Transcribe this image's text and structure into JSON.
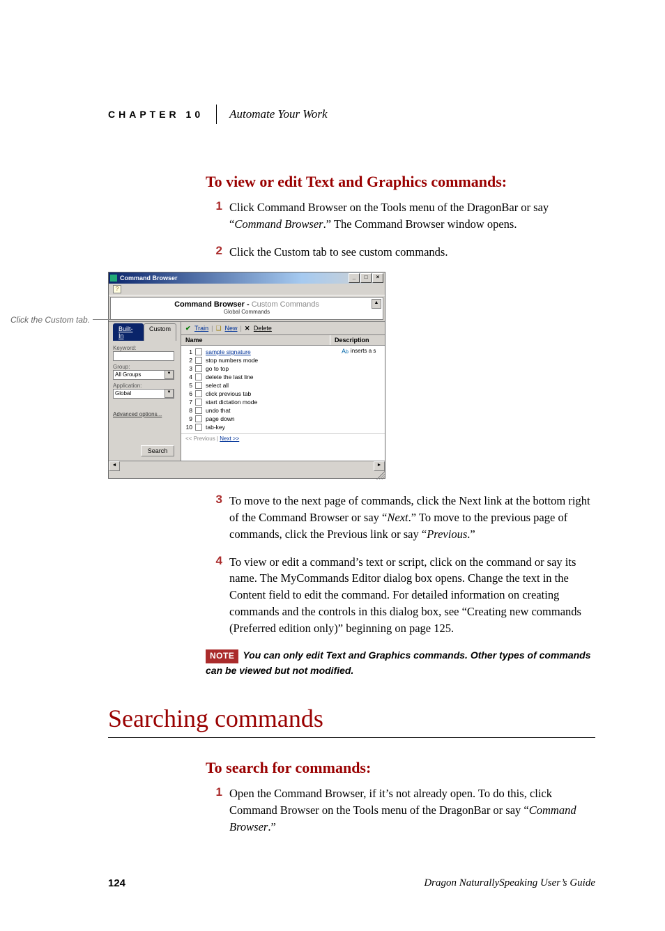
{
  "header": {
    "chapter_label": "CHAPTER 10",
    "chapter_title": "Automate Your Work"
  },
  "section1_heading": "To view or edit Text and Graphics commands:",
  "steps_a": [
    {
      "n": "1",
      "text_a": "Click Command Browser on the Tools menu of the DragonBar or say “",
      "ital": "Command Browser",
      "text_b": ".” The Command Browser window opens."
    },
    {
      "n": "2",
      "text_a": "Click the Custom tab to see custom commands.",
      "ital": "",
      "text_b": ""
    }
  ],
  "callout_text": "Click the Custom tab.",
  "cb": {
    "title": "Command Browser",
    "banner_bold": "Command Browser - ",
    "banner_gray": "Custom Commands",
    "banner_sub": "Global Commands",
    "tabs": {
      "builtin": "Built-In",
      "custom": "Custom"
    },
    "labels": {
      "keyword": "Keyword:",
      "group": "Group:",
      "application": "Application:"
    },
    "group_value": "All Groups",
    "application_value": "Global",
    "advanced_link": "Advanced options...",
    "search_btn": "Search",
    "toolbar": {
      "train": "Train",
      "new": "New",
      "delete": "Delete"
    },
    "col_name": "Name",
    "col_desc": "Description",
    "desc_first": "inserts a s",
    "rows": [
      {
        "i": "1",
        "name": "sample signature",
        "link": true
      },
      {
        "i": "2",
        "name": "stop numbers mode"
      },
      {
        "i": "3",
        "name": "go to top"
      },
      {
        "i": "4",
        "name": "delete the last line"
      },
      {
        "i": "5",
        "name": "select all"
      },
      {
        "i": "6",
        "name": "click previous tab"
      },
      {
        "i": "7",
        "name": "start dictation mode"
      },
      {
        "i": "8",
        "name": "undo that"
      },
      {
        "i": "9",
        "name": "page down"
      },
      {
        "i": "10",
        "name": "tab-key"
      }
    ],
    "pager_prev": "<< Previous",
    "pager_next": "Next >>"
  },
  "steps_b": [
    {
      "n": "3",
      "html": "To move to the next page of commands, click the Next link at the bottom right of the Command Browser or say “<i>Next</i>.” To move to the previous page of commands, click the Previous link or say “<i>Previous</i>.”"
    },
    {
      "n": "4",
      "html": "To view or edit a command’s text or script, click on the command or say its name. The MyCommands Editor dialog box opens. Change the text in the Content field to edit the command. For detailed information on creating commands and the controls in this dialog box, see “Creating new commands (Preferred edition only)” beginning on page 125."
    }
  ],
  "note_label": "NOTE",
  "note_text": "You can only edit Text and Graphics commands. Other types of commands can be viewed but not modified.",
  "big_heading": "Searching commands",
  "section2_heading": "To search for commands:",
  "steps_c": [
    {
      "n": "1",
      "html": "Open the Command Browser, if it’s not already open. To do this, click Command Browser on the Tools menu of the DragonBar or say “<i>Command Browser</i>.”"
    }
  ],
  "footer": {
    "page": "124",
    "book": "Dragon NaturallySpeaking User’s Guide"
  }
}
